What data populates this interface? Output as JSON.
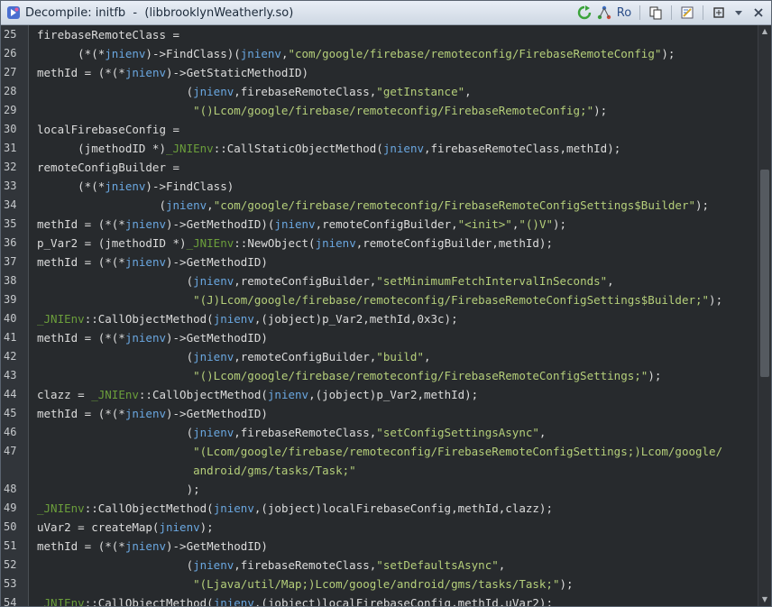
{
  "window": {
    "title": "Decompile: initfb  -  (libbrooklynWeatherly.so)",
    "toolbar": {
      "ro_label": "Ro"
    },
    "icons": [
      "decompile-icon",
      "refresh-icon",
      "graph-icon",
      "copy-icon",
      "export-icon",
      "snapshot-icon",
      "dropdown-icon",
      "close-icon"
    ]
  },
  "code": {
    "lines": [
      {
        "n": "25",
        "tokens": [
          [
            "p",
            "firebaseRemoteClass ="
          ]
        ]
      },
      {
        "n": "26",
        "tokens": [
          [
            "p",
            "      (*(*"
          ],
          [
            "i",
            "jnienv"
          ],
          [
            "p",
            ")->FindClass)("
          ],
          [
            "i",
            "jnienv"
          ],
          [
            "p",
            ","
          ],
          [
            "s",
            "\"com/google/firebase/remoteconfig/FirebaseRemoteConfig\""
          ],
          [
            "p",
            ");"
          ]
        ]
      },
      {
        "n": "27",
        "tokens": [
          [
            "p",
            "methId = (*(*"
          ],
          [
            "i",
            "jnienv"
          ],
          [
            "p",
            ")->GetStaticMethodID)"
          ]
        ]
      },
      {
        "n": "28",
        "tokens": [
          [
            "p",
            "                      ("
          ],
          [
            "i",
            "jnienv"
          ],
          [
            "p",
            ",firebaseRemoteClass,"
          ],
          [
            "s",
            "\"getInstance\""
          ],
          [
            "p",
            ","
          ]
        ]
      },
      {
        "n": "29",
        "tokens": [
          [
            "p",
            "                       "
          ],
          [
            "s",
            "\"()Lcom/google/firebase/remoteconfig/FirebaseRemoteConfig;\""
          ],
          [
            "p",
            ");"
          ]
        ]
      },
      {
        "n": "30",
        "tokens": [
          [
            "p",
            "localFirebaseConfig ="
          ]
        ]
      },
      {
        "n": "31",
        "tokens": [
          [
            "p",
            "      (jmethodID *)"
          ],
          [
            "j",
            "_JNIEnv"
          ],
          [
            "p",
            "::CallStaticObjectMethod("
          ],
          [
            "i",
            "jnienv"
          ],
          [
            "p",
            ",firebaseRemoteClass,methId);"
          ]
        ]
      },
      {
        "n": "32",
        "tokens": [
          [
            "p",
            "remoteConfigBuilder ="
          ]
        ]
      },
      {
        "n": "33",
        "tokens": [
          [
            "p",
            "      (*(*"
          ],
          [
            "i",
            "jnienv"
          ],
          [
            "p",
            ")->FindClass)"
          ]
        ]
      },
      {
        "n": "34",
        "tokens": [
          [
            "p",
            "                  ("
          ],
          [
            "i",
            "jnienv"
          ],
          [
            "p",
            ","
          ],
          [
            "s",
            "\"com/google/firebase/remoteconfig/FirebaseRemoteConfigSettings$Builder\""
          ],
          [
            "p",
            ");"
          ]
        ]
      },
      {
        "n": "35",
        "tokens": [
          [
            "p",
            "methId = (*(*"
          ],
          [
            "i",
            "jnienv"
          ],
          [
            "p",
            ")->GetMethodID)("
          ],
          [
            "i",
            "jnienv"
          ],
          [
            "p",
            ",remoteConfigBuilder,"
          ],
          [
            "s",
            "\"<init>\""
          ],
          [
            "p",
            ","
          ],
          [
            "s",
            "\"()V\""
          ],
          [
            "p",
            ");"
          ]
        ]
      },
      {
        "n": "36",
        "tokens": [
          [
            "p",
            "p_Var2 = (jmethodID *)"
          ],
          [
            "j",
            "_JNIEnv"
          ],
          [
            "p",
            "::NewObject("
          ],
          [
            "i",
            "jnienv"
          ],
          [
            "p",
            ",remoteConfigBuilder,methId);"
          ]
        ]
      },
      {
        "n": "37",
        "tokens": [
          [
            "p",
            "methId = (*(*"
          ],
          [
            "i",
            "jnienv"
          ],
          [
            "p",
            ")->GetMethodID)"
          ]
        ]
      },
      {
        "n": "38",
        "tokens": [
          [
            "p",
            "                      ("
          ],
          [
            "i",
            "jnienv"
          ],
          [
            "p",
            ",remoteConfigBuilder,"
          ],
          [
            "s",
            "\"setMinimumFetchIntervalInSeconds\""
          ],
          [
            "p",
            ","
          ]
        ]
      },
      {
        "n": "39",
        "tokens": [
          [
            "p",
            "                       "
          ],
          [
            "s",
            "\"(J)Lcom/google/firebase/remoteconfig/FirebaseRemoteConfigSettings$Builder;\""
          ],
          [
            "p",
            ");"
          ]
        ]
      },
      {
        "n": "40",
        "tokens": [
          [
            "j",
            "_JNIEnv"
          ],
          [
            "p",
            "::CallObjectMethod("
          ],
          [
            "i",
            "jnienv"
          ],
          [
            "p",
            ",(jobject)p_Var2,methId,0x3c);"
          ]
        ]
      },
      {
        "n": "41",
        "tokens": [
          [
            "p",
            "methId = (*(*"
          ],
          [
            "i",
            "jnienv"
          ],
          [
            "p",
            ")->GetMethodID)"
          ]
        ]
      },
      {
        "n": "42",
        "tokens": [
          [
            "p",
            "                      ("
          ],
          [
            "i",
            "jnienv"
          ],
          [
            "p",
            ",remoteConfigBuilder,"
          ],
          [
            "s",
            "\"build\""
          ],
          [
            "p",
            ","
          ]
        ]
      },
      {
        "n": "43",
        "tokens": [
          [
            "p",
            "                       "
          ],
          [
            "s",
            "\"()Lcom/google/firebase/remoteconfig/FirebaseRemoteConfigSettings;\""
          ],
          [
            "p",
            ");"
          ]
        ]
      },
      {
        "n": "44",
        "tokens": [
          [
            "p",
            "clazz = "
          ],
          [
            "j",
            "_JNIEnv"
          ],
          [
            "p",
            "::CallObjectMethod("
          ],
          [
            "i",
            "jnienv"
          ],
          [
            "p",
            ",(jobject)p_Var2,methId);"
          ]
        ]
      },
      {
        "n": "45",
        "tokens": [
          [
            "p",
            "methId = (*(*"
          ],
          [
            "i",
            "jnienv"
          ],
          [
            "p",
            ")->GetMethodID)"
          ]
        ]
      },
      {
        "n": "46",
        "tokens": [
          [
            "p",
            "                      ("
          ],
          [
            "i",
            "jnienv"
          ],
          [
            "p",
            ",firebaseRemoteClass,"
          ],
          [
            "s",
            "\"setConfigSettingsAsync\""
          ],
          [
            "p",
            ","
          ]
        ]
      },
      {
        "n": "47",
        "tall": true,
        "tokens": [
          [
            "p",
            "                       "
          ],
          [
            "s",
            "\"(Lcom/google/firebase/remoteconfig/FirebaseRemoteConfigSettings;)Lcom/google/\n                       android/gms/tasks/Task;\""
          ]
        ]
      },
      {
        "n": "48",
        "tokens": [
          [
            "p",
            "                      );"
          ]
        ]
      },
      {
        "n": "49",
        "tokens": [
          [
            "j",
            "_JNIEnv"
          ],
          [
            "p",
            "::CallObjectMethod("
          ],
          [
            "i",
            "jnienv"
          ],
          [
            "p",
            ",(jobject)localFirebaseConfig,methId,clazz);"
          ]
        ]
      },
      {
        "n": "50",
        "tokens": [
          [
            "p",
            "uVar2 = createMap("
          ],
          [
            "i",
            "jnienv"
          ],
          [
            "p",
            ");"
          ]
        ]
      },
      {
        "n": "51",
        "tokens": [
          [
            "p",
            "methId = (*(*"
          ],
          [
            "i",
            "jnienv"
          ],
          [
            "p",
            ")->GetMethodID)"
          ]
        ]
      },
      {
        "n": "52",
        "tokens": [
          [
            "p",
            "                      ("
          ],
          [
            "i",
            "jnienv"
          ],
          [
            "p",
            ",firebaseRemoteClass,"
          ],
          [
            "s",
            "\"setDefaultsAsync\""
          ],
          [
            "p",
            ","
          ]
        ]
      },
      {
        "n": "53",
        "tokens": [
          [
            "p",
            "                       "
          ],
          [
            "s",
            "\"(Ljava/util/Map;)Lcom/google/android/gms/tasks/Task;\""
          ],
          [
            "p",
            ");"
          ]
        ]
      },
      {
        "n": "54",
        "tokens": [
          [
            "j",
            "_JNIEnv"
          ],
          [
            "p",
            "::CallObjectMethod("
          ],
          [
            "i",
            "jnienv"
          ],
          [
            "p",
            ",(jobject)localFirebaseConfig,methId,uVar2);"
          ]
        ]
      }
    ]
  }
}
